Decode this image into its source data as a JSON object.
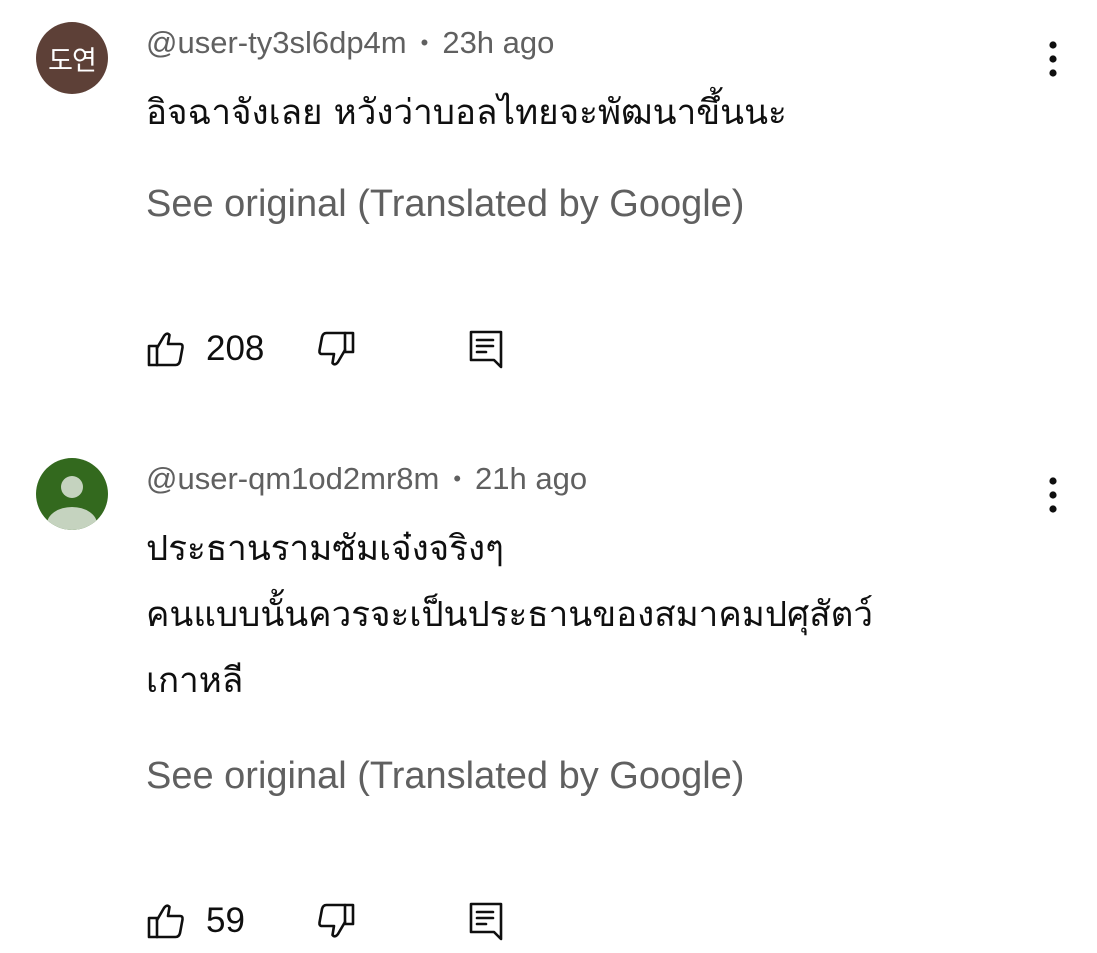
{
  "comments": [
    {
      "avatar": {
        "text": "도연",
        "color": "#5d4037"
      },
      "author": "@user-ty3sl6dp4m",
      "separator": "•",
      "time": "23h ago",
      "text": "อิจฉาจังเลย หวังว่าบอลไทยจะพัฒนาขึ้นนะ",
      "translation_link": "See original (Translated by Google)",
      "likes": "208",
      "icons": {
        "like": "thumbs-up-icon",
        "dislike": "thumbs-down-icon",
        "reply": "comment-icon",
        "menu": "more-vertical-icon"
      }
    },
    {
      "avatar": {
        "text": "",
        "color": "#33691e",
        "icon": "user-silhouette-icon"
      },
      "author": "@user-qm1od2mr8m",
      "separator": "•",
      "time": "21h ago",
      "text": "ประธานรามซัมเจ๋งจริงๆ\nคนแบบนั้นควรจะเป็นประธานของสมาคมปศุสัตว์\nเกาหลี",
      "translation_link": "See original (Translated by Google)",
      "likes": "59",
      "icons": {
        "like": "thumbs-up-icon",
        "dislike": "thumbs-down-icon",
        "reply": "comment-icon",
        "menu": "more-vertical-icon"
      }
    }
  ],
  "colors": {
    "secondary_text": "#606060",
    "primary_text": "#0f0f0f",
    "background": "#ffffff"
  }
}
